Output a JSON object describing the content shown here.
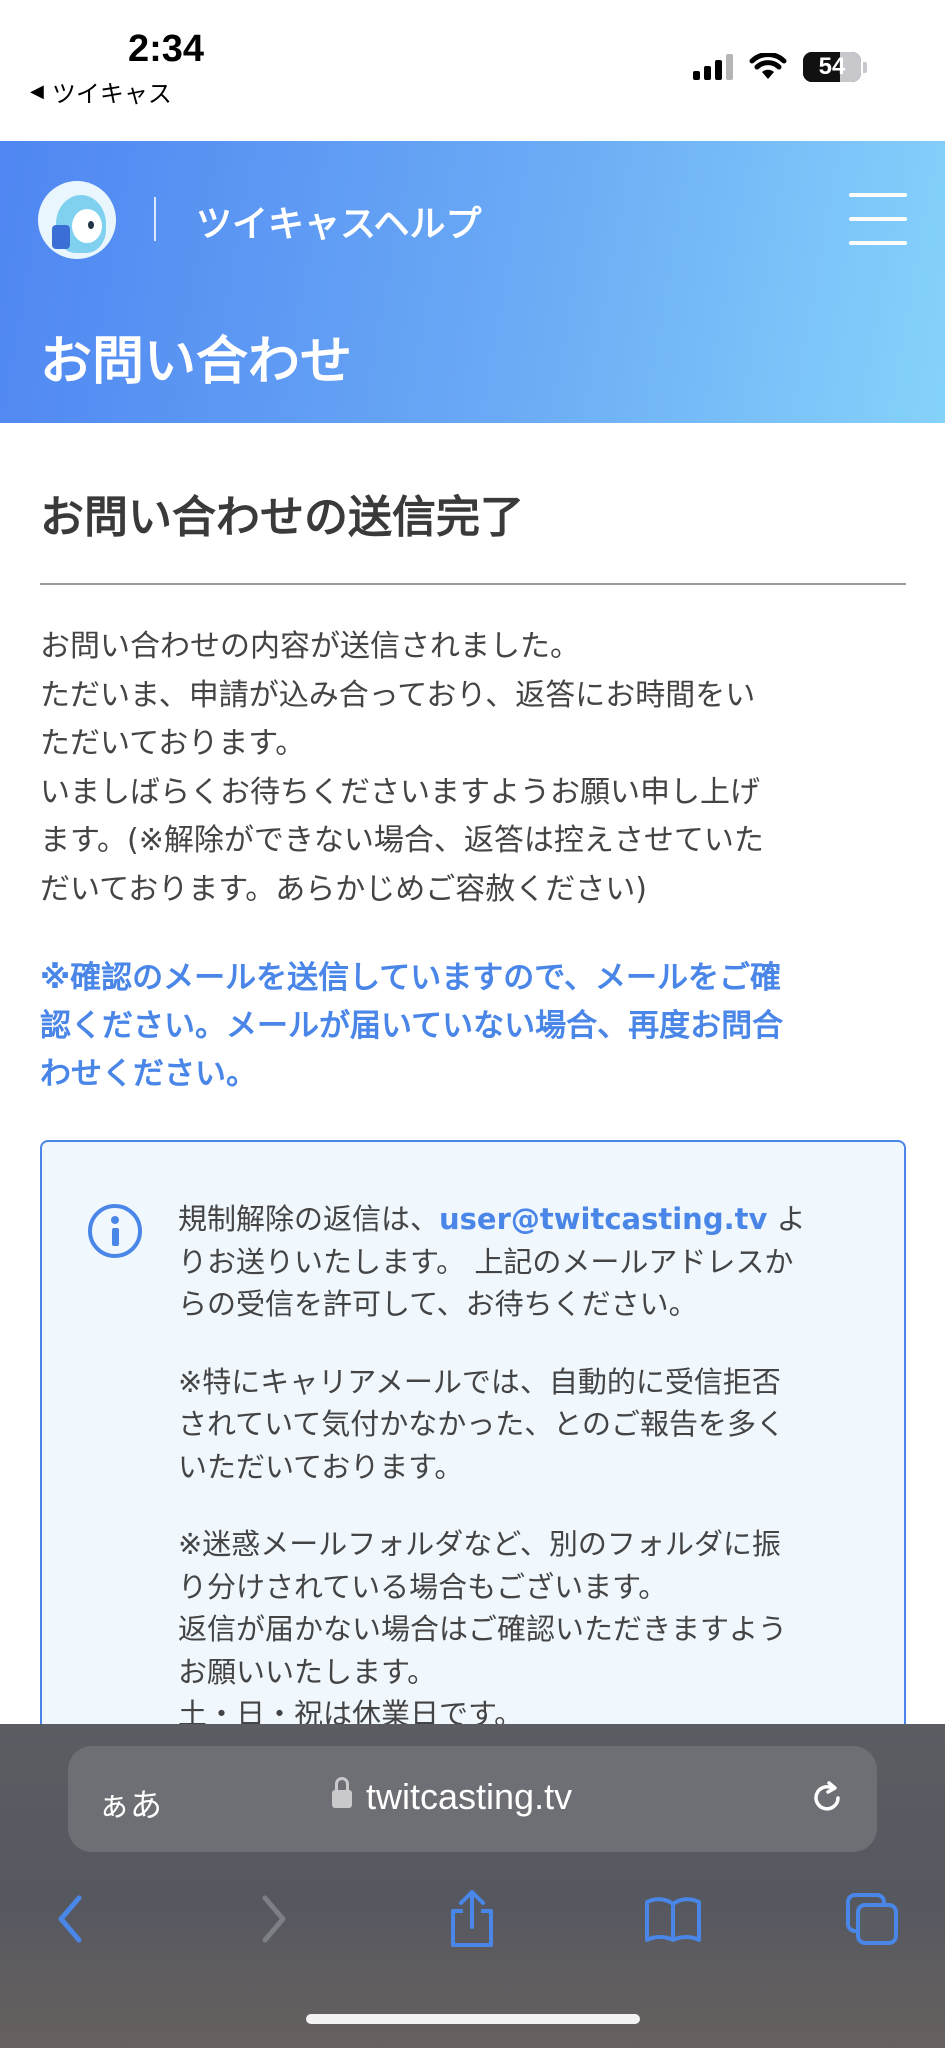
{
  "status_bar": {
    "time": "2:34",
    "back_app": "ツイキャス",
    "battery": "54",
    "icons": [
      "signal-icon",
      "wifi-icon",
      "battery-icon"
    ]
  },
  "header": {
    "site_title": "ツイキャスヘルプ",
    "page_heading": "お問い合わせ",
    "gradient_colors": [
      "#4f86f2",
      "#85d2fb"
    ]
  },
  "main": {
    "section_title": "お問い合わせの送信完了",
    "message_lines": [
      "お問い合わせの内容が送信されました。",
      "ただいま、申請が込み合っており、返答にお時間をい",
      "ただいております。",
      "いましばらくお待ちくださいますようお願い申し上げ",
      "ます。(※解除ができない場合、返答は控えさせていた",
      "だいております。あらかじめご容赦ください)"
    ],
    "notice_lines": [
      "※確認のメールを送信していますので、メールをご確",
      "認ください。メールが届いていない場合、再度お問合",
      "わせください。"
    ],
    "accent_color": "#4a86e8"
  },
  "info_box": {
    "line1_prefix": "規制解除の返信は、",
    "email": "user@twitcasting.tv",
    "line1_suffix": " よ",
    "lines_a": [
      "りお送りいたします。 上記のメールアドレスか",
      "らの受信を許可して、お待ちください。"
    ],
    "lines_b": [
      "※特にキャリアメールでは、自動的に受信拒否",
      "されていて気付かなかった、とのご報告を多く",
      "いただいております。"
    ],
    "lines_c": [
      "※迷惑メールフォルダなど、別のフォルダに振",
      "り分けされている場合もございます。",
      "返信が届かない場合はご確認いただきますよう",
      "お願いいたします。",
      "土・日・祝は休業日です。"
    ]
  },
  "browser": {
    "text_size_button": "ぁあ",
    "url": "twitcasting.tv",
    "toolbar": [
      "back-icon",
      "forward-icon",
      "share-icon",
      "bookmarks-icon",
      "tabs-icon"
    ]
  }
}
